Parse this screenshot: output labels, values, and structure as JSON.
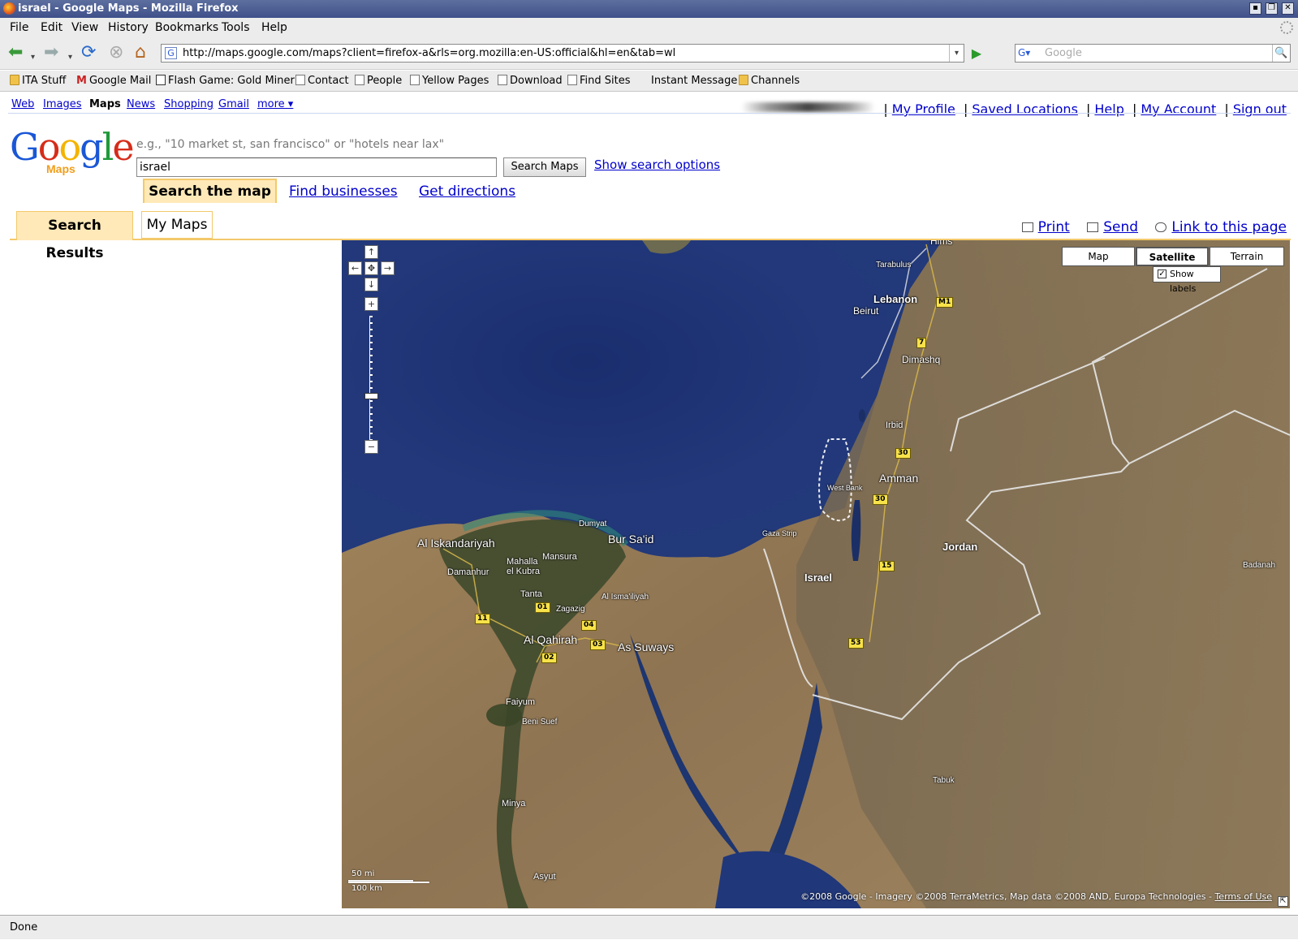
{
  "window": {
    "title": "israel - Google Maps - Mozilla Firefox"
  },
  "menu": {
    "items": [
      "File",
      "Edit",
      "View",
      "History",
      "Bookmarks",
      "Tools",
      "Help"
    ]
  },
  "navigation": {
    "url": "http://maps.google.com/maps?client=firefox-a&rls=org.mozilla:en-US:official&hl=en&tab=wl",
    "search_placeholder": "Google"
  },
  "bookmarks": [
    {
      "label": "ITA Stuff",
      "icon": "folder-icon"
    },
    {
      "label": "Google Mail",
      "icon": "gmail-icon"
    },
    {
      "label": "Flash Game: Gold Miner",
      "icon": "game-icon"
    },
    {
      "label": "Contact",
      "icon": "page-icon"
    },
    {
      "label": "People",
      "icon": "page-icon"
    },
    {
      "label": "Yellow Pages",
      "icon": "page-icon"
    },
    {
      "label": "Download",
      "icon": "page-icon"
    },
    {
      "label": "Find Sites",
      "icon": "page-icon"
    },
    {
      "label": "Instant Message",
      "icon": "none"
    },
    {
      "label": "Channels",
      "icon": "folder-icon"
    }
  ],
  "google_bar": {
    "links": [
      "Web",
      "Images",
      "Maps",
      "News",
      "Shopping",
      "Gmail",
      "more ▾"
    ],
    "current": "Maps",
    "user_links": [
      "My Profile",
      "Saved Locations",
      "Help",
      "My Account",
      "Sign out"
    ]
  },
  "search": {
    "logo_main": "Google",
    "logo_sub": "Maps",
    "hint": "e.g., \"10 market st, san francisco\" or \"hotels near lax\"",
    "query": "israel",
    "button": "Search Maps",
    "options_link": "Show search options",
    "tabs": [
      "Search the map",
      "Find businesses",
      "Get directions"
    ]
  },
  "panel_tabs": {
    "results": "Search Results",
    "mymaps": "My Maps"
  },
  "page_links": [
    "Print",
    "Send",
    "Link to this page"
  ],
  "map": {
    "types": [
      "Map",
      "Satellite",
      "Terrain"
    ],
    "active_type": "Satellite",
    "show_labels": "Show labels",
    "show_labels_checked": true,
    "zoom_level_fraction": 0.62,
    "places": [
      "Hims",
      "Tarabulus",
      "Lebanon",
      "Beirut",
      "Dimashq",
      "Irbid",
      "Amman",
      "West Bank",
      "Gaza Strip",
      "Jordan",
      "Israel",
      "Badanah",
      "Dumyat",
      "Bur Sa'id",
      "Al Iskandariyah",
      "Damanhur",
      "Mahalla el Kubra",
      "Mansura",
      "Tanta",
      "Zagazig",
      "Al Isma'iliyah",
      "Al Qahirah",
      "As Suways",
      "Faiyum",
      "Beni Suef",
      "Minya",
      "Asyut",
      "Tabuk"
    ],
    "roads": [
      "M1",
      "7",
      "30",
      "30",
      "15",
      "53",
      "11",
      "01",
      "04",
      "03",
      "02"
    ],
    "scale_mi": "50 mi",
    "scale_km": "100 km",
    "copyright": "©2008 Google - Imagery ©2008 TerraMetrics, Map data ©2008 AND, Europa Technologies - ",
    "terms": "Terms of Use"
  },
  "status": "Done"
}
